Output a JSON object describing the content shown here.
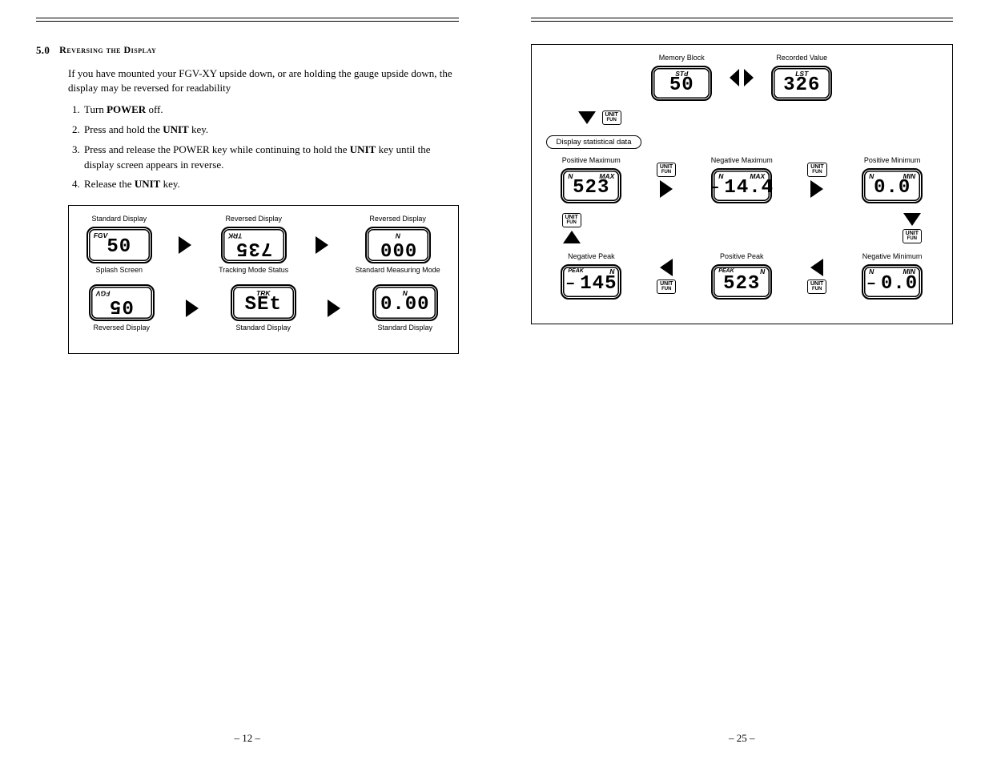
{
  "left": {
    "section_num": "5.0",
    "section_title": "Reversing the Display",
    "intro": "If you have mounted your FGV-XY upside down, or are holding the gauge upside down, the display may be reversed for readability",
    "steps": [
      {
        "pre": "Turn ",
        "bold": "POWER",
        "post": " off."
      },
      {
        "pre": "Press and hold the ",
        "bold": "UNIT",
        "post": " key."
      },
      {
        "pre": "Press and release the POWER key while continuing to hold the ",
        "bold": "UNIT",
        "post": " key until the display screen appears in reverse."
      },
      {
        "pre": "Release the ",
        "bold": "UNIT",
        "post": " key."
      }
    ],
    "diagram": {
      "top": [
        {
          "cap_above": "Standard Display",
          "top": "FGV",
          "main": "50",
          "cap_below": "Splash Screen",
          "flip": false
        },
        {
          "cap_above": "Reversed Display",
          "top": "TRK",
          "main": "735",
          "cap_below": "Tracking Mode Status",
          "flip": true
        },
        {
          "cap_above": "Reversed Display",
          "top": "N",
          "main": "000",
          "cap_below": "Standard Measuring Mode",
          "flip": true
        }
      ],
      "bottom": [
        {
          "cap_above": "",
          "top": "FGV",
          "main": "05",
          "cap_below": "Reversed Display",
          "flip": true
        },
        {
          "cap_above": "",
          "top": "TRK",
          "main": "SEt",
          "cap_below": "Standard Display",
          "flip": false
        },
        {
          "cap_above": "",
          "top": "N",
          "main": "0.00",
          "cap_below": "Standard Display",
          "flip": false
        }
      ]
    },
    "page_num": "– 12 –"
  },
  "right": {
    "top_screens": [
      {
        "label": "Memory Block",
        "top": "STd",
        "main": "50"
      },
      {
        "label": "Recorded Value",
        "top": "LST",
        "main": "326"
      }
    ],
    "stat_label": "Display statistical data",
    "unit_label": "UNIT",
    "unit_sub": "FUN",
    "stats": {
      "row1": [
        {
          "label": "Positive Maximum",
          "top_l": "N",
          "top_r": "MAX",
          "neg": false,
          "main": "523"
        },
        {
          "label": "Negative Maximum",
          "top_l": "N",
          "top_r": "MAX",
          "neg": true,
          "main": "14.4"
        },
        {
          "label": "Positive Minimum",
          "top_l": "N",
          "top_r": "MIN",
          "neg": false,
          "main": "0.0"
        }
      ],
      "row2": [
        {
          "label": "Negative Peak",
          "peak": true,
          "top_l": "N",
          "top_r": "",
          "neg": true,
          "main": "145"
        },
        {
          "label": "Positive Peak",
          "peak": true,
          "top_l": "N",
          "top_r": "",
          "neg": false,
          "main": "523"
        },
        {
          "label": "Negative Minimum",
          "peak": false,
          "top_l": "N",
          "top_r": "MIN",
          "neg": true,
          "main": "0.0"
        }
      ]
    },
    "page_num": "– 25 –"
  }
}
